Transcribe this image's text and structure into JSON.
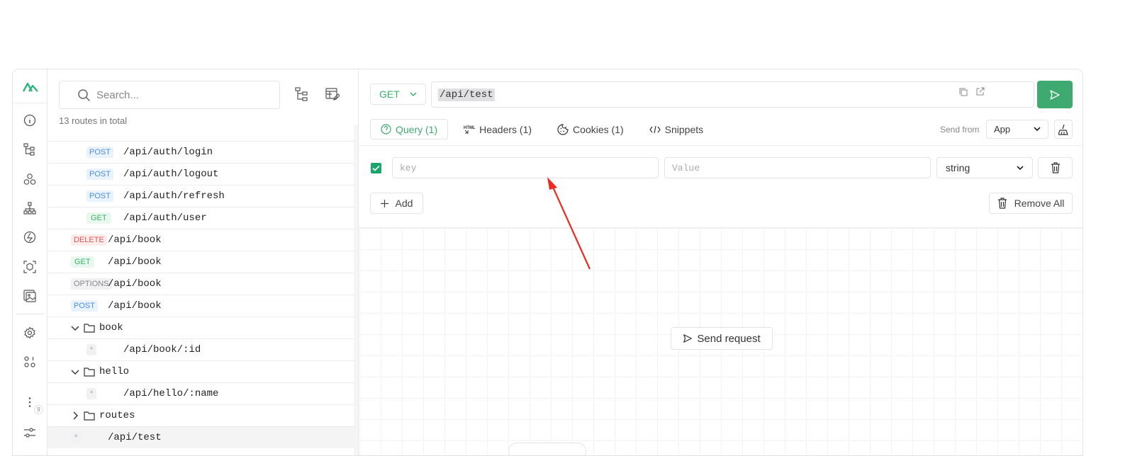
{
  "search": {
    "placeholder": "Search..."
  },
  "routes_total": "13 routes in total",
  "routes": [
    {
      "method": "POST",
      "path": "/api/auth/login"
    },
    {
      "method": "POST",
      "path": "/api/auth/logout"
    },
    {
      "method": "POST",
      "path": "/api/auth/refresh"
    },
    {
      "method": "GET",
      "path": "/api/auth/user"
    },
    {
      "method": "DELETE",
      "path": "/api/book"
    },
    {
      "method": "GET",
      "path": "/api/book"
    },
    {
      "method": "OPTIONS",
      "path": "/api/book"
    },
    {
      "method": "POST",
      "path": "/api/book"
    },
    {
      "folder": "book"
    },
    {
      "method": "*",
      "path": "/api/book/:id"
    },
    {
      "folder": "hello"
    },
    {
      "method": "*",
      "path": "/api/hello/:name"
    },
    {
      "folder": "routes"
    },
    {
      "method": "*",
      "path": "/api/test"
    }
  ],
  "request": {
    "method": "GET",
    "url": "/api/test"
  },
  "tabs": {
    "query": "Query (1)",
    "headers": "Headers (1)",
    "cookies": "Cookies (1)",
    "snippets": "Snippets"
  },
  "send_from": {
    "label": "Send from",
    "value": "App"
  },
  "query_row": {
    "key_placeholder": "key",
    "value_placeholder": "Value",
    "type": "string"
  },
  "buttons": {
    "add": "Add",
    "remove_all": "Remove All",
    "send_request": "Send request"
  },
  "rail_badge": "9",
  "colors": {
    "accent": "#3eaa70",
    "get": "#3bb26a",
    "post": "#4a8fe0",
    "delete": "#e25555"
  }
}
